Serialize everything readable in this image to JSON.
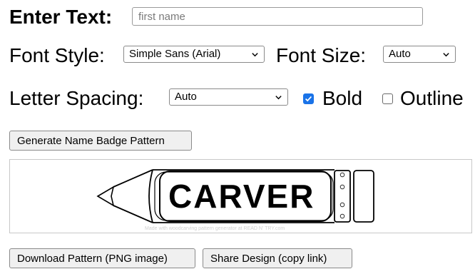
{
  "form": {
    "enter_text_label": "Enter Text:",
    "text_placeholder": "first name",
    "text_value": "",
    "font_style_label": "Font Style:",
    "font_style_value": "Simple Sans (Arial)",
    "font_size_label": "Font Size:",
    "font_size_value": "Auto",
    "letter_spacing_label": "Letter Spacing:",
    "letter_spacing_value": "Auto",
    "bold_label": "Bold",
    "bold_checked": true,
    "outline_label": "Outline",
    "outline_checked": false
  },
  "buttons": {
    "generate": "Generate Name Badge Pattern",
    "download": "Download Pattern (PNG image)",
    "share": "Share Design (copy link)"
  },
  "preview": {
    "badge_text": "CARVER",
    "watermark": "Made with woodcarving pattern generator at READ N' TRY.com"
  },
  "icons": {
    "dropdown": "chevron-down-icon",
    "check": "check-icon",
    "pencil": "pencil-outline-icon"
  },
  "colors": {
    "checkbox_checked": "#1a73e8",
    "button_bg": "#f0f0f0",
    "border": "#8a8a8a"
  }
}
